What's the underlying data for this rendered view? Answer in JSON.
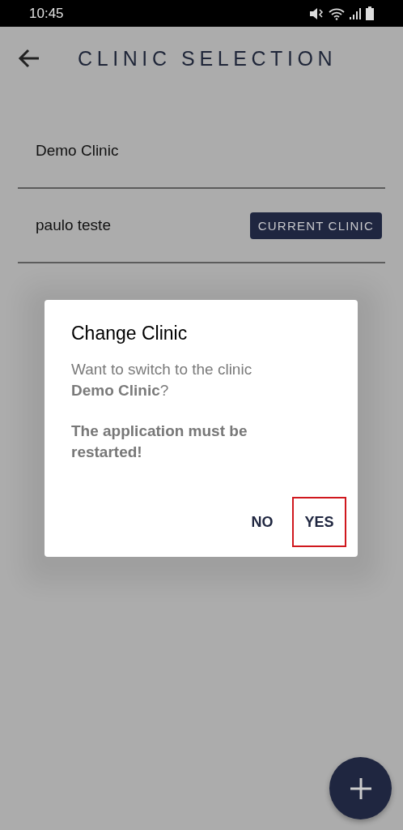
{
  "status_bar": {
    "time": "10:45"
  },
  "app_bar": {
    "title": "CLINIC SELECTION"
  },
  "clinics": [
    {
      "name": "Demo Clinic"
    },
    {
      "name": "paulo teste",
      "badge": "CURRENT CLINIC"
    }
  ],
  "dialog": {
    "title": "Change Clinic",
    "message": "Want to switch to the clinic **Demo Clinic**?",
    "warning": "The application must be restarted!",
    "buttons": [
      {
        "label": "NO",
        "highlighted": false
      },
      {
        "label": "YES",
        "highlighted": true
      }
    ]
  }
}
